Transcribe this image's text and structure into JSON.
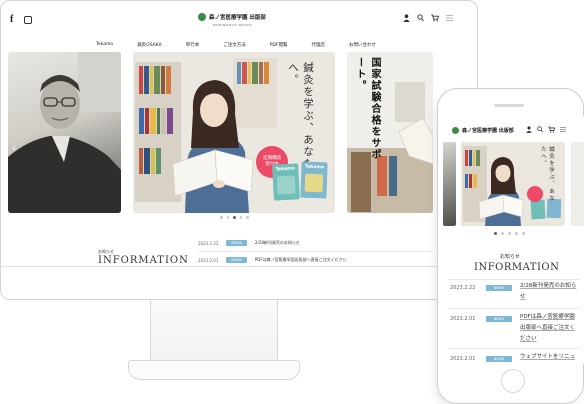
{
  "site": {
    "logo_text": "森ノ宮医療学園 出版部",
    "logo_sub": "MORINOMIYA BOOKS",
    "facebook_glyph": "f",
    "header_icons": [
      "user-icon",
      "search-icon",
      "cart-icon",
      "menu-icon"
    ]
  },
  "nav": {
    "items": [
      "Tekamo",
      "鍼灸OSAKA",
      "単行本",
      "ご注文方法",
      "PDF閲覧",
      "代理店",
      "お問い合わせ"
    ]
  },
  "hero": {
    "copy": "鍼灸を学ぶ、あなたへ。",
    "badge_line1": "定期購読",
    "badge_line2": "受付中",
    "book_title": "Tekamo",
    "side_copy": "国家試験合格をサポート。",
    "slide_count": 5,
    "active_slide": 2
  },
  "news": {
    "label_small": "お知らせ",
    "label_big": "INFORMATION",
    "items": [
      {
        "date": "2023.2.22",
        "tag": "NEWS",
        "title": "2/28新刊発売のお知らせ"
      },
      {
        "date": "2023.2.01",
        "tag": "NEWS",
        "title": "PDFは森ノ宮医療学園出版部へ直接ご注文ください"
      }
    ]
  },
  "phone": {
    "logo_text": "森ノ宮医療学園 出版部",
    "hero_copy": "鍼灸を学ぶ、あなたへ。",
    "label_small": "お知らせ",
    "label_big": "INFORMATION",
    "news": [
      {
        "date": "2023.2.22",
        "tag": "NEWS",
        "title": "2/28新刊発売のお知らせ"
      },
      {
        "date": "2023.2.01",
        "tag": "NEWS",
        "title": "PDFは森ノ宮医療学園出版部へ直接ご注文ください"
      },
      {
        "date": "2023.2.01",
        "tag": "NEWS",
        "title": "ウェブサイトをリニュ"
      }
    ]
  },
  "colors": {
    "brand_green": "#3a8a4a",
    "news_tag": "#7eb8d6",
    "badge_red": "#ec4a67"
  }
}
